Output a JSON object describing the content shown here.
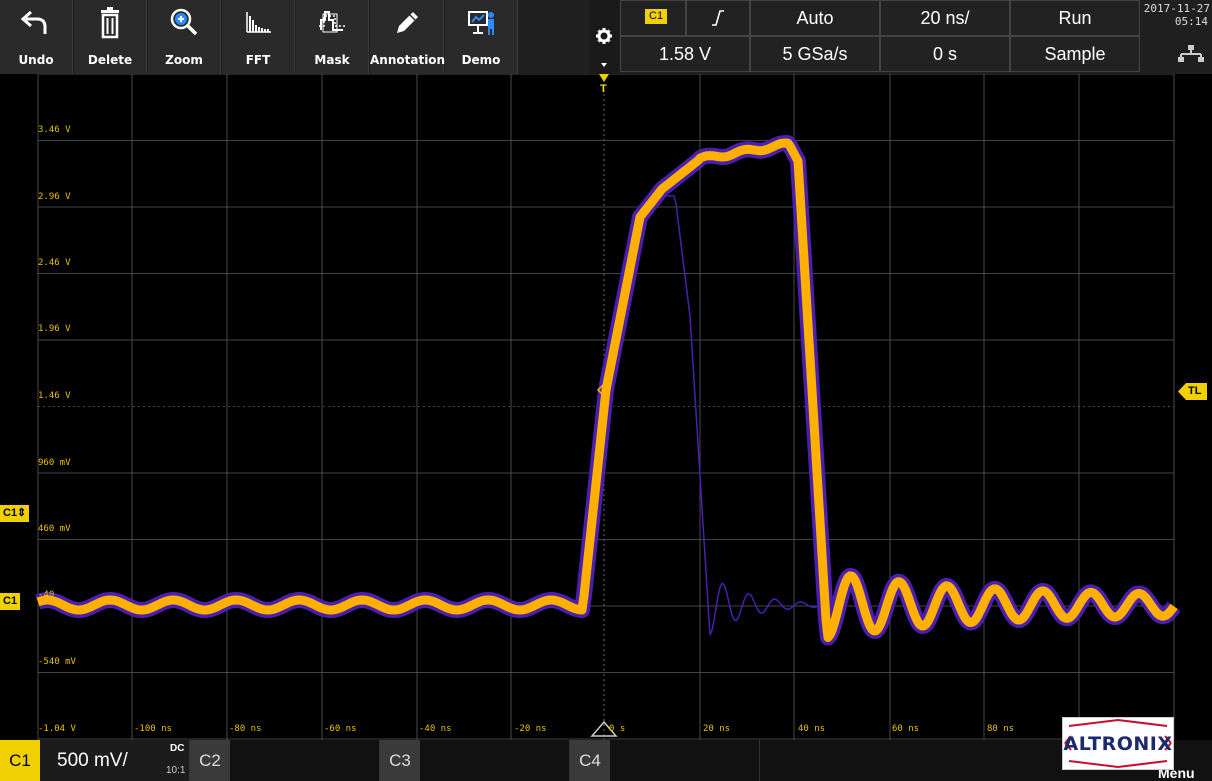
{
  "toolbar": {
    "buttons": [
      {
        "label": "Undo",
        "icon": "undo-arrow-icon"
      },
      {
        "label": "Delete",
        "icon": "trash-icon"
      },
      {
        "label": "Zoom",
        "icon": "zoom-plus-icon"
      },
      {
        "label": "FFT",
        "icon": "fft-spectrum-icon"
      },
      {
        "label": "Mask",
        "icon": "mask-icon"
      },
      {
        "label": "Annotation",
        "icon": "pencil-icon"
      },
      {
        "label": "Demo",
        "icon": "presenter-icon"
      }
    ]
  },
  "status": {
    "trigger_source": "C1",
    "trigger_slope_symbol": "⨍",
    "trigger_mode": "Auto",
    "timebase": "20 ns/",
    "run_state": "Run",
    "trigger_level": "1.58 V",
    "sample_rate": "5 GSa/s",
    "horizontal_position": "0 s",
    "acquisition_mode": "Sample",
    "date": "2017-11-27",
    "time": "05:14"
  },
  "waveform": {
    "voltage_labels": [
      "3.46 V",
      "2.96 V",
      "2.46 V",
      "1.96 V",
      "1.46 V",
      "960 mV",
      "460 mV",
      "-40",
      "-540 mV",
      "-1.04 V"
    ],
    "time_labels": [
      "-100 ns",
      "-80 ns",
      "-60 ns",
      "-40 ns",
      "-20 ns",
      "0 s",
      "20 ns",
      "40 ns",
      "60 ns",
      "80 ns"
    ],
    "trigger_marker": "T",
    "trigger_level_marker": "TL",
    "offset_marker": "C1⇕",
    "channel_marker": "C1",
    "colors": {
      "trace": "#ffb000",
      "persistence": "#4a1fb0",
      "grid": "#5a5a5a",
      "label": "#e8c200"
    }
  },
  "channels": [
    {
      "name": "C1",
      "scale": "500 mV/",
      "coupling": "DC",
      "probe": "10:1",
      "active": true
    },
    {
      "name": "C2",
      "active": false
    },
    {
      "name": "C3",
      "active": false
    },
    {
      "name": "C4",
      "active": false
    }
  ],
  "menu_label": "Menu",
  "logo_text": "ALTRONIX"
}
